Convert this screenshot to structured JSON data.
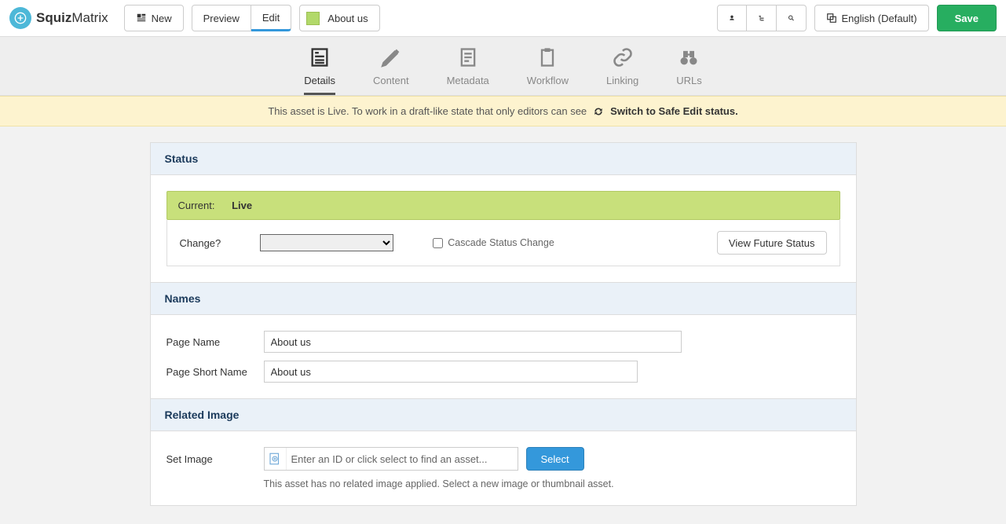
{
  "logo": {
    "boldPart": "Squiz",
    "lightPart": "Matrix"
  },
  "topBar": {
    "newLabel": "New",
    "previewLabel": "Preview",
    "editLabel": "Edit",
    "assetName": "About us",
    "languageLabel": "English (Default)",
    "saveLabel": "Save"
  },
  "subTabs": {
    "details": "Details",
    "content": "Content",
    "metadata": "Metadata",
    "workflow": "Workflow",
    "linking": "Linking",
    "urls": "URLs"
  },
  "notice": {
    "text": "This asset is Live. To work in a draft-like state that only editors can see",
    "action": "Switch to Safe Edit status."
  },
  "statusPanel": {
    "heading": "Status",
    "currentLabel": "Current:",
    "currentValue": "Live",
    "changeLabel": "Change?",
    "cascadeLabel": "Cascade Status Change",
    "futureBtn": "View Future Status"
  },
  "namesPanel": {
    "heading": "Names",
    "pageNameLabel": "Page Name",
    "pageNameValue": "About us",
    "shortNameLabel": "Page Short Name",
    "shortNameValue": "About us"
  },
  "imagePanel": {
    "heading": "Related Image",
    "setImageLabel": "Set Image",
    "placeholder": "Enter an ID or click select to find an asset...",
    "selectBtn": "Select",
    "hint": "This asset has no related image applied. Select a new image or thumbnail asset."
  }
}
